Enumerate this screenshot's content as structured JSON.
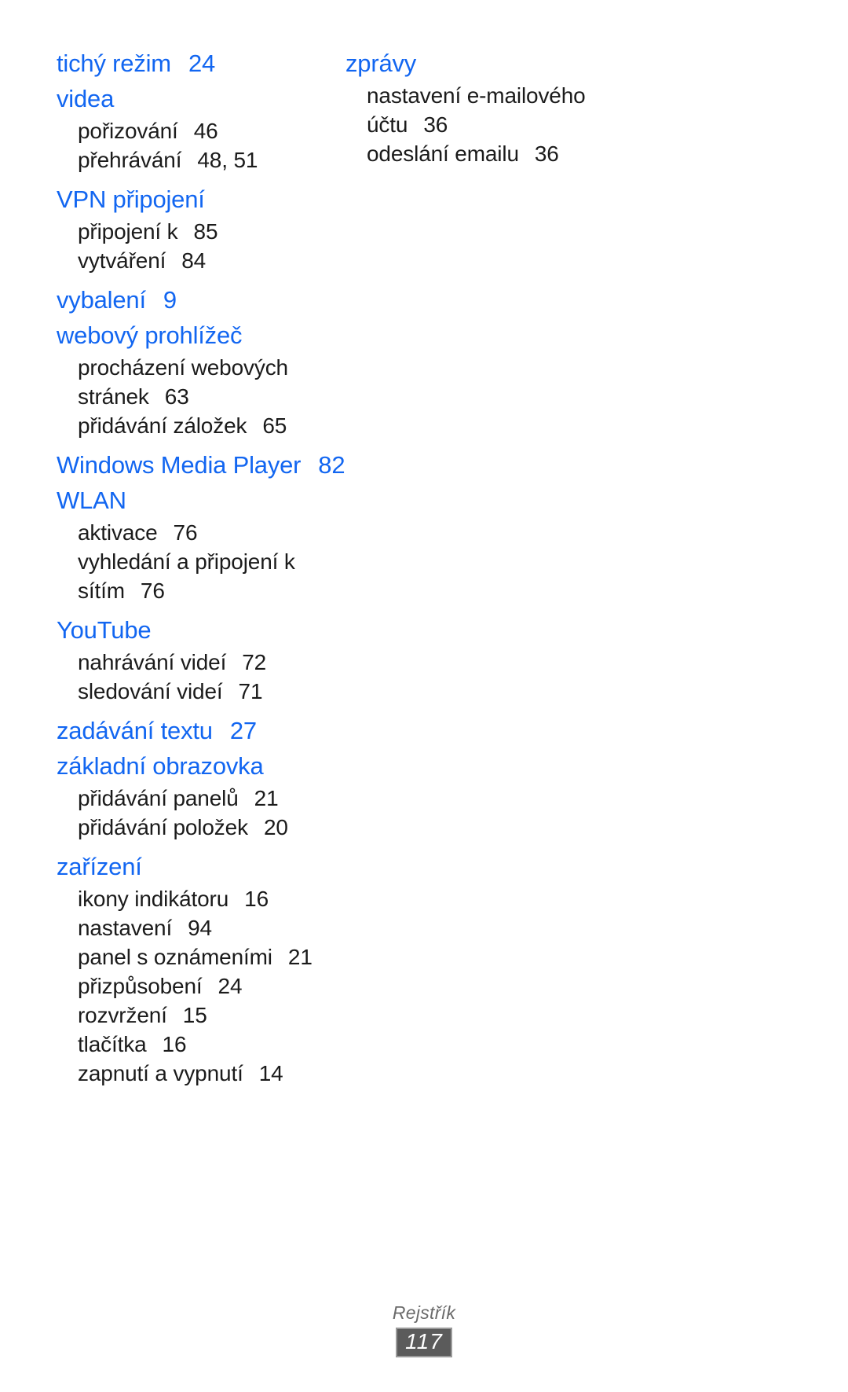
{
  "page": {
    "footer_label": "Rejstřík",
    "page_number": "117",
    "heading_color": "#1266f1",
    "text_color": "#1b1b1b",
    "badge_bg_color": "#5b5b5b",
    "badge_border_color": "#9a9a9a",
    "footer_label_color": "#6b6b6b"
  },
  "columns": {
    "left": [
      {
        "heading": "tichý režim",
        "heading_page": "24",
        "entries": []
      },
      {
        "heading": "videa",
        "heading_page": "",
        "entries": [
          {
            "label": "pořizování",
            "page": "46"
          },
          {
            "label": "přehrávání",
            "page": "48, 51"
          }
        ]
      },
      {
        "heading": "VPN připojení",
        "heading_page": "",
        "entries": [
          {
            "label": "připojení k",
            "page": "85"
          },
          {
            "label": "vytváření",
            "page": "84"
          }
        ]
      },
      {
        "heading": "vybalení",
        "heading_page": "9",
        "entries": []
      },
      {
        "heading": "webový prohlížeč",
        "heading_page": "",
        "entries": [
          {
            "label": "procházení webových stránek",
            "page": "63"
          },
          {
            "label": "přidávání záložek",
            "page": "65"
          }
        ]
      },
      {
        "heading": "Windows Media Player",
        "heading_page": "82",
        "entries": []
      },
      {
        "heading": "WLAN",
        "heading_page": "",
        "entries": [
          {
            "label": "aktivace",
            "page": "76"
          },
          {
            "label": "vyhledání a připojení k sítím",
            "page": "76"
          }
        ]
      },
      {
        "heading": "YouTube",
        "heading_page": "",
        "entries": [
          {
            "label": "nahrávání videí",
            "page": "72"
          },
          {
            "label": "sledování videí",
            "page": "71"
          }
        ]
      },
      {
        "heading": "zadávání textu",
        "heading_page": "27",
        "entries": []
      },
      {
        "heading": "základní obrazovka",
        "heading_page": "",
        "entries": [
          {
            "label": "přidávání panelů",
            "page": "21"
          },
          {
            "label": "přidávání položek",
            "page": "20"
          }
        ]
      },
      {
        "heading": "zařízení",
        "heading_page": "",
        "entries": [
          {
            "label": "ikony indikátoru",
            "page": "16"
          },
          {
            "label": "nastavení",
            "page": "94"
          },
          {
            "label": "panel s oznámeními",
            "page": "21"
          },
          {
            "label": "přizpůsobení",
            "page": "24"
          },
          {
            "label": "rozvržení",
            "page": "15"
          },
          {
            "label": "tlačítka",
            "page": "16"
          },
          {
            "label": "zapnutí a vypnutí",
            "page": "14"
          }
        ]
      }
    ],
    "right": [
      {
        "heading": "zprávy",
        "heading_page": "",
        "entries": [
          {
            "label": "nastavení e-mailového účtu",
            "page": "36"
          },
          {
            "label": "odeslání emailu",
            "page": "36"
          }
        ]
      }
    ]
  }
}
